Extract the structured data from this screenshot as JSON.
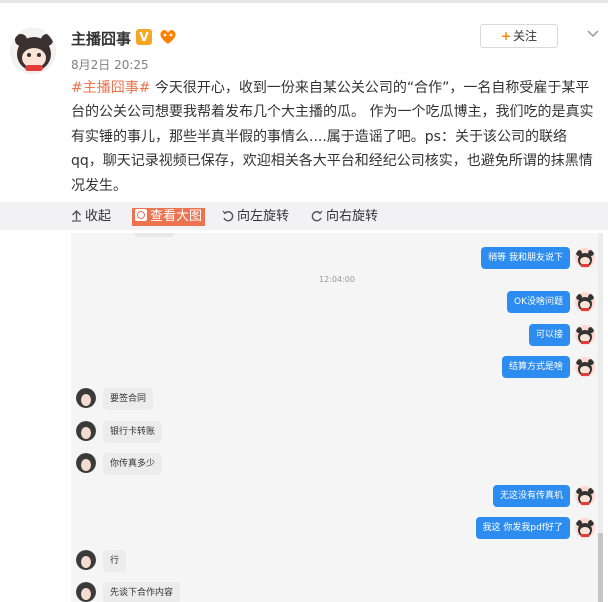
{
  "post": {
    "username": "主播囧事",
    "verified_badge": "V",
    "timestamp": "8月2日 20:25",
    "follow_label": "关注",
    "text_hashtag": "#主播囧事#",
    "text_body": " 今天很开心，收到一份来自某公关公司的“合作”，一名自称受雇于某平台的公关公司想要我帮着发布几个大主播的瓜。 作为一个吃瓜博主，我们吃的是真实有实锤的事儿，那些半真半假的事情么....属于造谣了吧。ps：关于该公司的联络qq，聊天记录视频已保存，欢迎相关各大平台和经纪公司核实，也避免所谓的抹黑情况发生。",
    "accent_color": "#eb7350"
  },
  "toolbar": {
    "collapse": "收起",
    "view_large": "查看大图",
    "rotate_left": "向左旋转",
    "rotate_right": "向右旋转"
  },
  "chat": {
    "time_label": "12:04:00",
    "messages": [
      {
        "side": "right",
        "text": "稍等 我和朋友说下"
      },
      {
        "side": "right",
        "text": "OK没啥问题"
      },
      {
        "side": "right",
        "text": "可以接"
      },
      {
        "side": "right",
        "text": "结算方式是啥"
      },
      {
        "side": "left",
        "text": "要签合同"
      },
      {
        "side": "left",
        "text": "银行卡转账"
      },
      {
        "side": "left",
        "text": "你传真多少"
      },
      {
        "side": "right",
        "text": "无这没有传真机"
      },
      {
        "side": "right",
        "text": "我这 你发我pdf好了"
      },
      {
        "side": "left",
        "text": "行"
      },
      {
        "side": "left",
        "text": "先谈下合作内容"
      }
    ],
    "bubble_color": "#2d8cf0"
  }
}
